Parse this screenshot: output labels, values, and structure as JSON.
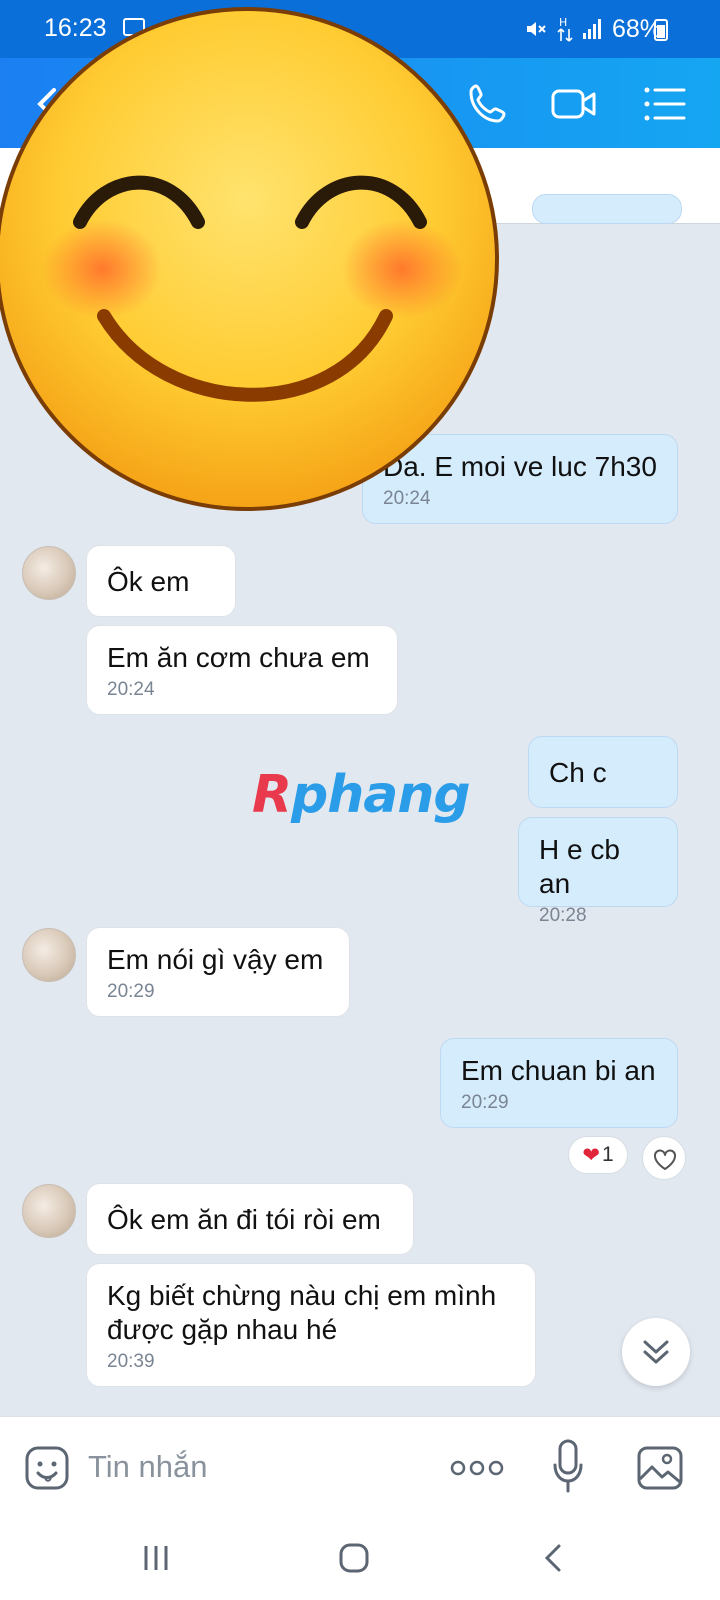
{
  "status_bar": {
    "time": "16:23",
    "battery": "68%"
  },
  "composer": {
    "placeholder": "Tin nhắn"
  },
  "watermark": {
    "r": "R",
    "rest": "phang"
  },
  "messages": [
    {
      "dir": "out",
      "text": "Da. E moi ve luc 7h30",
      "time": "20:24"
    },
    {
      "dir": "in",
      "text": "Ôk em",
      "time": ""
    },
    {
      "dir": "in",
      "text": "Em ăn cơm chưa em",
      "time": "20:24"
    },
    {
      "dir": "out",
      "text": "Ch c",
      "time": ""
    },
    {
      "dir": "out",
      "text": "H e cb an",
      "time": "20:28"
    },
    {
      "dir": "in",
      "text": "Em nói gì vậy em",
      "time": "20:29"
    },
    {
      "dir": "out",
      "text": "Em chuan bi an",
      "time": "20:29"
    },
    {
      "dir": "in",
      "text": "Ôk em ăn đi tói ròi em",
      "time": ""
    },
    {
      "dir": "in",
      "text": "Kg biết chừng nàu chị em mình\nđược gặp nhau hé",
      "time": "20:39"
    }
  ],
  "reaction": {
    "emoji": "❤",
    "count": "1"
  },
  "icons": {
    "header": [
      "back-arrow-icon",
      "phone-icon",
      "video-call-icon",
      "list-menu-icon"
    ],
    "composer": [
      "sticker-icon",
      "more-options-icon",
      "microphone-icon",
      "image-icon"
    ],
    "navbar": [
      "recent-apps-icon",
      "home-icon",
      "back-icon"
    ]
  },
  "colors": {
    "header": "#1b7ff2",
    "incoming": "#ffffff",
    "outgoing": "#d5ecfd",
    "chat_bg": "#e2e8f0"
  }
}
